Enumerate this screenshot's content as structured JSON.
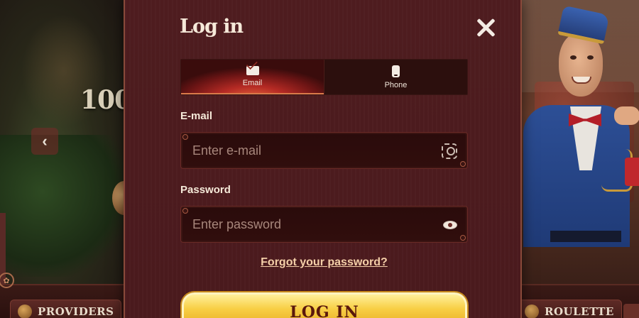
{
  "background": {
    "promo_text": "100",
    "nav_left_icon": "chevron-left-icon",
    "bottom_nav": {
      "providers_label": "PROVIDERS",
      "roulette_label": "ROULETTE"
    }
  },
  "modal": {
    "title": "Log in",
    "close_icon": "close-icon",
    "tabs": [
      {
        "label": "Email",
        "icon": "envelope-icon",
        "active": true
      },
      {
        "label": "Phone",
        "icon": "smartphone-icon",
        "active": false
      }
    ],
    "email": {
      "label": "E-mail",
      "placeholder": "Enter e-mail",
      "value": "",
      "icon": "face-scan-icon"
    },
    "password": {
      "label": "Password",
      "placeholder": "Enter password",
      "value": "",
      "icon": "eye-icon"
    },
    "forgot_link": "Forgot your password?",
    "submit_label": "LOG IN"
  },
  "colors": {
    "modal_bg": "#4a1a1d",
    "accent_gold": "#f8cf45",
    "active_tab": "#b52a24",
    "text": "#f6ead9"
  }
}
